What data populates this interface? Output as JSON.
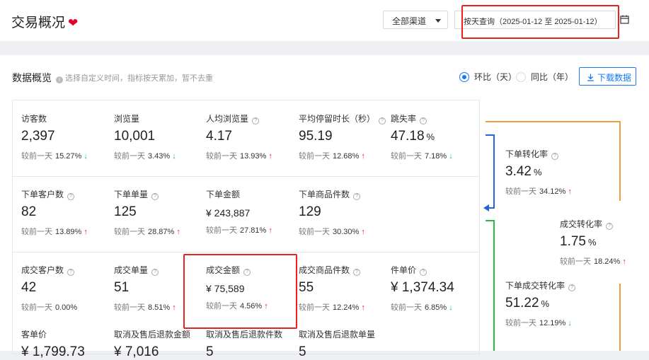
{
  "header": {
    "title": "交易概况",
    "heart": "❤",
    "channel": "全部渠道",
    "date_range": "按天查询（2025-01-12 至 2025-01-12）"
  },
  "section": {
    "title": "数据概览",
    "hint": "选择自定义时间，指标按天累加，暂不去重",
    "radio_day": "环比（天）",
    "radio_year": "同比（年）",
    "download": "下载数据"
  },
  "compare_label": "较前一天",
  "metrics": [
    {
      "label": "访客数",
      "value": "2,397",
      "pct": "15.27%",
      "dir": "down",
      "help": false
    },
    {
      "label": "浏览量",
      "value": "10,001",
      "pct": "3.43%",
      "dir": "down",
      "help": false
    },
    {
      "label": "人均浏览量",
      "value": "4.17",
      "pct": "13.93%",
      "dir": "up",
      "help": true
    },
    {
      "label": "平均停留时长（秒）",
      "value": "95.19",
      "pct": "12.68%",
      "dir": "up",
      "help": true
    },
    {
      "label": "跳失率",
      "value": "47.18",
      "unit": "%",
      "pct": "7.18%",
      "dir": "down",
      "help": true
    },
    {
      "label": "下单客户数",
      "value": "82",
      "pct": "13.89%",
      "dir": "up",
      "help": true
    },
    {
      "label": "下单单量",
      "value": "125",
      "pct": "28.87%",
      "dir": "up",
      "help": true
    },
    {
      "label": "下单金额",
      "value": "¥ 243,887",
      "money": true,
      "pct": "27.81%",
      "dir": "up",
      "help": false
    },
    {
      "label": "下单商品件数",
      "value": "129",
      "pct": "30.30%",
      "dir": "up",
      "help": true
    },
    {
      "label": "成交客户数",
      "value": "42",
      "pct": "0.00%",
      "dir": "",
      "help": true
    },
    {
      "label": "成交单量",
      "value": "51",
      "pct": "8.51%",
      "dir": "up",
      "help": true
    },
    {
      "label": "成交金额",
      "value": "¥ 75,589",
      "money": true,
      "pct": "4.56%",
      "dir": "up",
      "help": true
    },
    {
      "label": "成交商品件数",
      "value": "55",
      "pct": "12.24%",
      "dir": "up",
      "help": true
    },
    {
      "label": "件单价",
      "value": "¥ 1,374.34",
      "pct": "6.85%",
      "dir": "down",
      "help": true
    },
    {
      "label": "客单价",
      "value": "¥ 1,799.73",
      "partial": true
    },
    {
      "label": "取消及售后退款金额",
      "value": "¥ 7,016",
      "partial": true
    },
    {
      "label": "取消及售后退款件数",
      "value": "5",
      "partial": true
    },
    {
      "label": "取消及售后退款单量",
      "value": "5",
      "partial": true
    }
  ],
  "flow": [
    {
      "label": "下单转化率",
      "value": "3.42",
      "unit": "%",
      "pct": "34.12%",
      "dir": "up"
    },
    {
      "label": "成交转化率",
      "value": "1.75",
      "unit": "%",
      "pct": "18.24%",
      "dir": "up"
    },
    {
      "label": "下单成交转化率",
      "value": "51.22",
      "unit": "%",
      "pct": "12.19%",
      "dir": "down"
    }
  ],
  "icons": {
    "calendar": "calendar-icon",
    "download": "download-icon",
    "info": "info-icon",
    "help": "help-icon"
  },
  "colors": {
    "accent": "#1677ff",
    "up": "#e8231f",
    "down": "#2dba3f",
    "highlight": "#e8231f",
    "orange": "#f29b38",
    "blue": "#2563d9",
    "green": "#2dba3f"
  }
}
